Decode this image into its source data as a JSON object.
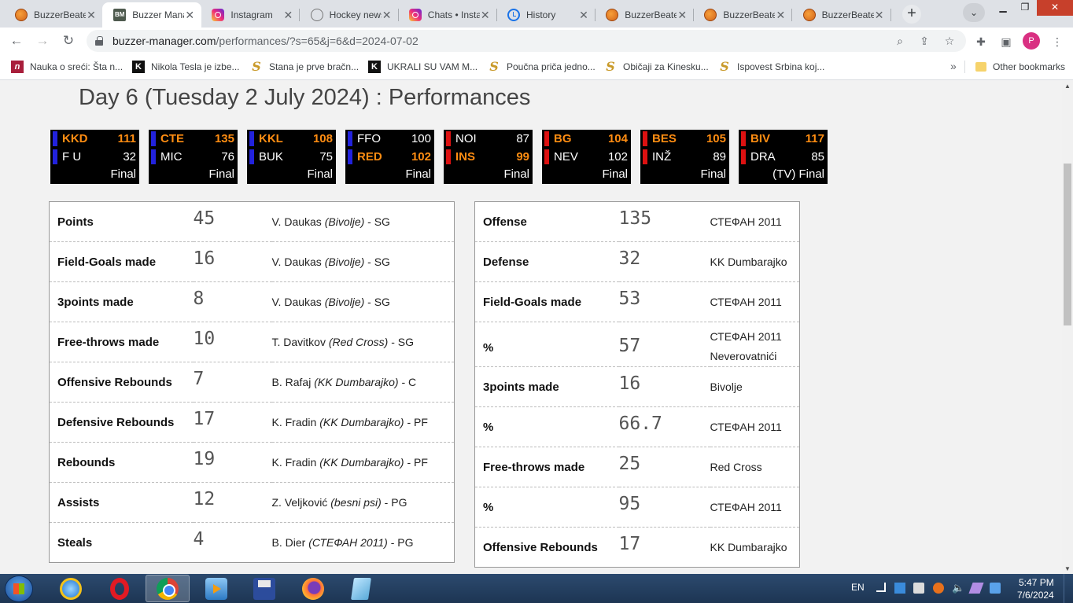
{
  "tabs": [
    {
      "label": "BuzzerBeater",
      "icon": "basketball-icon",
      "active": false
    },
    {
      "label": "Buzzer Manager",
      "icon": "bm-icon",
      "active": true
    },
    {
      "label": "Instagram",
      "icon": "instagram-icon",
      "active": false
    },
    {
      "label": "Hockey news",
      "icon": "link-icon",
      "active": false
    },
    {
      "label": "Chats • Instagram",
      "icon": "instagram-icon",
      "active": false
    },
    {
      "label": "History",
      "icon": "history-icon",
      "active": false
    },
    {
      "label": "BuzzerBeater",
      "icon": "basketball-icon",
      "active": false
    },
    {
      "label": "BuzzerBeater",
      "icon": "basketball-icon",
      "active": false
    },
    {
      "label": "BuzzerBeater",
      "icon": "basketball-icon",
      "active": false
    }
  ],
  "toolbar": {
    "url_host": "buzzer-manager.com",
    "url_path": "/performances/?s=65&j=6&d=2024-07-02",
    "profile_initial": "P"
  },
  "bookmarks": [
    {
      "label": "Nauka o sreći: Šta n...",
      "icon": "n-icon"
    },
    {
      "label": "Nikola Tesla je izbe...",
      "icon": "k-icon"
    },
    {
      "label": "Stana je prve bračn...",
      "icon": "s-icon"
    },
    {
      "label": "UKRALI SU VAM M...",
      "icon": "k-icon"
    },
    {
      "label": "Poučna priča jedno...",
      "icon": "s-icon"
    },
    {
      "label": "Običaji za Kinesku...",
      "icon": "s-icon"
    },
    {
      "label": "Ispovest Srbina koj...",
      "icon": "s-icon"
    }
  ],
  "other_bookmarks": "Other bookmarks",
  "page": {
    "title": "Day 6 (Tuesday 2 July 2024) : Performances"
  },
  "colors": {
    "winner": "#ff8d12",
    "home_bar": "#2222dd",
    "away_bar": "#dd1111"
  },
  "scoreboards": [
    {
      "t1": "KKD",
      "s1": "111",
      "t2": "F U",
      "s2": "32",
      "winner": 1,
      "bar": "blue",
      "status": "Final"
    },
    {
      "t1": "CTE",
      "s1": "135",
      "t2": "MIC",
      "s2": "76",
      "winner": 1,
      "bar": "blue",
      "status": "Final"
    },
    {
      "t1": "KKL",
      "s1": "108",
      "t2": "BUK",
      "s2": "75",
      "winner": 1,
      "bar": "blue",
      "status": "Final"
    },
    {
      "t1": "FFO",
      "s1": "100",
      "t2": "RED",
      "s2": "102",
      "winner": 2,
      "bar": "blue",
      "status": "Final"
    },
    {
      "t1": "NOI",
      "s1": "87",
      "t2": "INS",
      "s2": "99",
      "winner": 2,
      "bar": "red",
      "status": "Final"
    },
    {
      "t1": "BG",
      "s1": "104",
      "t2": "NEV",
      "s2": "102",
      "winner": 1,
      "bar": "red",
      "status": "Final"
    },
    {
      "t1": "BES",
      "s1": "105",
      "t2": "INŽ",
      "s2": "89",
      "winner": 1,
      "bar": "red",
      "status": "Final"
    },
    {
      "t1": "BIV",
      "s1": "117",
      "t2": "DRA",
      "s2": "85",
      "winner": 1,
      "bar": "red",
      "status": "(TV) Final"
    }
  ],
  "player_stats": [
    {
      "label": "Points",
      "value": "45",
      "player": "V. Daukas",
      "team": "(Bivolje)",
      "pos": " - SG"
    },
    {
      "label": "Field-Goals made",
      "value": "16",
      "player": "V. Daukas",
      "team": "(Bivolje)",
      "pos": " - SG"
    },
    {
      "label": "3points made",
      "value": "8",
      "player": "V. Daukas",
      "team": "(Bivolje)",
      "pos": " - SG"
    },
    {
      "label": "Free-throws made",
      "value": "10",
      "player": "T. Davitkov",
      "team": "(Red Cross)",
      "pos": " - SG"
    },
    {
      "label": "Offensive Rebounds",
      "value": "7",
      "player": "B. Rafaj",
      "team": "(KK Dumbarajko)",
      "pos": " - C"
    },
    {
      "label": "Defensive Rebounds",
      "value": "17",
      "player": "K. Fradin",
      "team": "(KK Dumbarajko)",
      "pos": " - PF"
    },
    {
      "label": "Rebounds",
      "value": "19",
      "player": "K. Fradin",
      "team": "(KK Dumbarajko)",
      "pos": " - PF"
    },
    {
      "label": "Assists",
      "value": "12",
      "player": "Z. Veljković",
      "team": "(besni psi)",
      "pos": " - PG"
    },
    {
      "label": "Steals",
      "value": "4",
      "player": "B. Dier",
      "team": "(СТЕФАН 2011)",
      "pos": " - PG"
    }
  ],
  "team_stats": [
    {
      "label": "Offense",
      "value": "135",
      "teams": [
        "СТЕФАН 2011"
      ]
    },
    {
      "label": "Defense",
      "value": "32",
      "teams": [
        "KK Dumbarajko"
      ]
    },
    {
      "label": "Field-Goals made",
      "value": "53",
      "teams": [
        "СТЕФАН 2011"
      ]
    },
    {
      "label": "%",
      "value": "57",
      "teams": [
        "СТЕФАН 2011",
        "Neverovatnići"
      ]
    },
    {
      "label": "3points made",
      "value": "16",
      "teams": [
        "Bivolje"
      ]
    },
    {
      "label": "%",
      "value": "66.7",
      "teams": [
        "СТЕФАН 2011"
      ]
    },
    {
      "label": "Free-throws made",
      "value": "25",
      "teams": [
        "Red Cross"
      ]
    },
    {
      "label": "%",
      "value": "95",
      "teams": [
        "СТЕФАН 2011"
      ]
    },
    {
      "label": "Offensive Rebounds",
      "value": "17",
      "teams": [
        "KK Dumbarajko"
      ]
    }
  ],
  "taskbar": {
    "apps": [
      {
        "name": "internet-explorer-icon",
        "active": false
      },
      {
        "name": "opera-icon",
        "active": false
      },
      {
        "name": "chrome-icon",
        "active": true
      },
      {
        "name": "media-player-icon",
        "active": false
      },
      {
        "name": "floppy-icon",
        "active": false
      },
      {
        "name": "firefox-icon",
        "active": false
      },
      {
        "name": "notepad-icon",
        "active": false
      }
    ],
    "language": "EN",
    "time": "5:47 PM",
    "date": "7/6/2024"
  }
}
